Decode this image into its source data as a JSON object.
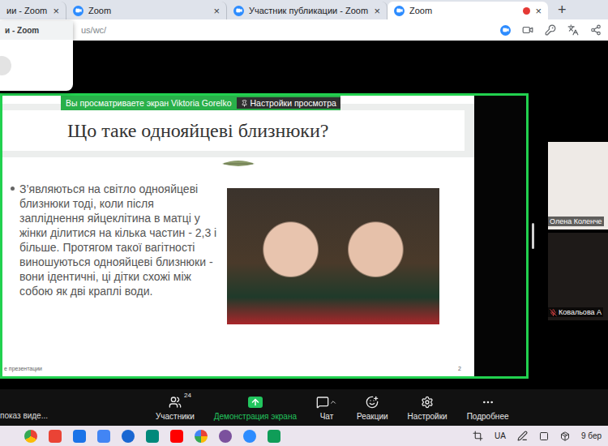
{
  "browser": {
    "tabs": [
      {
        "label": "ии - Zoom",
        "close": "×",
        "selected": false,
        "recording": false
      },
      {
        "label": "Zoom",
        "close": "×",
        "selected": false,
        "recording": false
      },
      {
        "label": "Участник публикации - Zoom",
        "close": "×",
        "selected": false,
        "recording": false
      },
      {
        "label": "Zoom",
        "close": "×",
        "selected": true,
        "recording": true
      }
    ],
    "new_tab": "+",
    "url": "us/wc/",
    "tab_preview": {
      "title": "и - Zoom"
    }
  },
  "share": {
    "banner": "Вы просматриваете экран Viktoria Gorelko",
    "view_settings": "Настройки просмотра",
    "slide": {
      "title": "Що таке однояйцеві близнюки?",
      "bullet": "З’являються на світло однояйцеві близнюки тоді, коли після запліднення яйцеклітина в матці у жінки ділитися на кілька частин - 2,3 і більше. Протягом такої вагітності виношуються однояйцеві близнюки - вони ідентичні, ці дітки схожі між собою як дві краплі води.",
      "footer": "е презентации",
      "page": "2"
    }
  },
  "participants": [
    {
      "name": "Олена Коленче",
      "muted": false
    },
    {
      "name": "Ковальова А",
      "muted": true
    }
  ],
  "toolbar": {
    "left_label": "показ виде...",
    "buttons": [
      {
        "label": "Участники",
        "badge": "24",
        "kind": "participants"
      },
      {
        "label": "Демонстрация экрана",
        "kind": "share"
      },
      {
        "label": "Чат",
        "kind": "chat"
      },
      {
        "label": "Реакции",
        "kind": "reactions"
      },
      {
        "label": "Настройки",
        "kind": "settings"
      },
      {
        "label": "Подробнее",
        "kind": "more"
      }
    ]
  },
  "taskbar": {
    "language": "UA",
    "date": "9 бер"
  }
}
